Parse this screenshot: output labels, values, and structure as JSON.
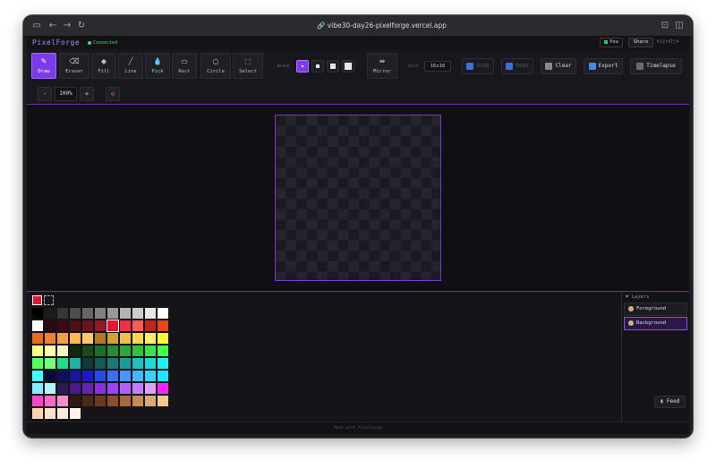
{
  "browser": {
    "url": "vibe30-day26-pixelforge.vercel.app"
  },
  "app": {
    "logo": "PixelForge",
    "connection_status": "Connected",
    "user_label": "You",
    "share_label": "Share",
    "room_id": "kf2r47j4"
  },
  "toolbar": {
    "tools": [
      {
        "id": "draw",
        "label": "Draw",
        "icon": "pencil-icon",
        "glyph": "✎",
        "active": true
      },
      {
        "id": "eraser",
        "label": "Eraser",
        "icon": "eraser-icon",
        "glyph": "⌫",
        "active": false
      },
      {
        "id": "fill",
        "label": "Fill",
        "icon": "fill-icon",
        "glyph": "◆",
        "active": false
      },
      {
        "id": "line",
        "label": "Line",
        "icon": "line-icon",
        "glyph": "╱",
        "active": false
      },
      {
        "id": "pick",
        "label": "Pick",
        "icon": "eyedropper-icon",
        "glyph": "💧",
        "active": false
      },
      {
        "id": "rect",
        "label": "Rect",
        "icon": "rect-icon",
        "glyph": "▭",
        "active": false
      },
      {
        "id": "circle",
        "label": "Circle",
        "icon": "circle-icon",
        "glyph": "○",
        "active": false
      },
      {
        "id": "select",
        "label": "Select",
        "icon": "select-icon",
        "glyph": "⬚",
        "active": false
      }
    ],
    "brush_label": "Brush",
    "mirror_label": "Mirror",
    "grid_label": "Grid",
    "grid_value": "16x16",
    "undo_label": "Undo",
    "redo_label": "Redo",
    "clear_label": "Clear",
    "export_label": "Export",
    "timelapse_label": "Timelapse",
    "zoom_out": "-",
    "zoom_value": "100%",
    "zoom_in": "+"
  },
  "palette": {
    "selected_color": "#e5172f",
    "colors": [
      "#000000",
      "#1c1c1c",
      "#363636",
      "#4d4d4d",
      "#666666",
      "#808080",
      "#999999",
      "#b3b3b3",
      "#cccccc",
      "#e6e6e6",
      "#ffffff",
      "#ffffff",
      "#2a0a0e",
      "#3a0c12",
      "#4d1018",
      "#6b1420",
      "#8f1a28",
      "#e5172f",
      "#f03040",
      "#ff5a5a",
      "#c0261a",
      "#e8451c",
      "#e86a1c",
      "#f08030",
      "#f5a040",
      "#ffb84d",
      "#ffc86b",
      "#b07a2a",
      "#d6a030",
      "#f0c040",
      "#ffd84d",
      "#ffee66",
      "#ffff33",
      "#ffff88",
      "#ffffb0",
      "#f5f5c0",
      "#0d2a0d",
      "#1a4a1a",
      "#1f6b2a",
      "#2a8a35",
      "#2aa83a",
      "#30c040",
      "#3ce04a",
      "#44ff4c",
      "#55ff66",
      "#77ff88",
      "#22dd88",
      "#1fb0a0",
      "#0f3a3a",
      "#145858",
      "#1a7878",
      "#1f9a9a",
      "#22c0b8",
      "#22d8d0",
      "#22f0f0",
      "#44ffff",
      "#0a0a3a",
      "#101060",
      "#16169a",
      "#1a1ac8",
      "#2a4ae0",
      "#3a70f0",
      "#4a96ff",
      "#4ab4ff",
      "#3cd0ff",
      "#22e6ff",
      "#88eaff",
      "#b0f4ff",
      "#2a1a5a",
      "#4a1a8a",
      "#6a22b0",
      "#8a30d8",
      "#a040ff",
      "#b060ff",
      "#c080ff",
      "#dda0ff",
      "#ff22ff",
      "#ff44cc",
      "#ff66cc",
      "#ff8acc",
      "#2a1a10",
      "#4a2a18",
      "#6a3a1f",
      "#8a4f2a",
      "#a86838",
      "#c48a58",
      "#dcaa78",
      "#f0c890",
      "#ffd4b0",
      "#ffe0c8",
      "#ffeadc",
      "#fff4ec"
    ]
  },
  "layers": {
    "title": "Layers",
    "items": [
      {
        "name": "Foreground",
        "active": false
      },
      {
        "name": "Background",
        "active": true
      }
    ],
    "feed_label": "Feed"
  },
  "footer": {
    "text": "Made with PixelForge"
  }
}
